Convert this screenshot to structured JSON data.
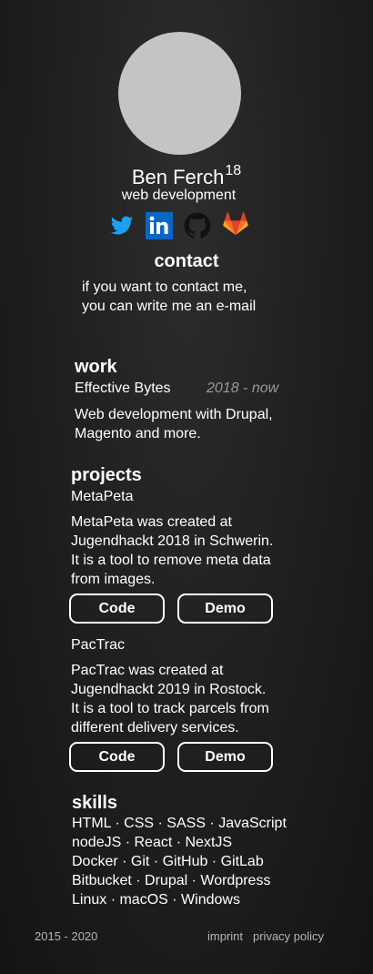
{
  "profile": {
    "name": "Ben Ferch",
    "age": "18",
    "tagline": "web development"
  },
  "socials": [
    {
      "icon": "twitter-icon",
      "color": "#1da1f2"
    },
    {
      "icon": "linkedin-icon",
      "color": "#0a66c2"
    },
    {
      "icon": "github-icon",
      "color": "#111111"
    },
    {
      "icon": "gitlab-icon",
      "color": "#fc6d26"
    }
  ],
  "contact": {
    "title": "contact",
    "line1": "if you want to contact me,",
    "line2": "you can write me an e-mail"
  },
  "work": {
    "title": "work",
    "company": "Effective Bytes",
    "period": "2018 - now",
    "desc_line1": "Web development with Drupal,",
    "desc_line2": "Magento and more."
  },
  "projects": {
    "title": "projects",
    "items": [
      {
        "name": "MetaPeta",
        "lines": [
          "MetaPeta was created at",
          "Jugendhackt 2018 in Schwerin.",
          "It is a tool to remove meta data",
          "from images."
        ],
        "code_label": "Code",
        "demo_label": "Demo"
      },
      {
        "name": "PacTrac",
        "lines": [
          "PacTrac was created at",
          "Jugendhackt 2019 in Rostock.",
          "It is a tool to track parcels from",
          "different delivery services."
        ],
        "code_label": "Code",
        "demo_label": "Demo"
      }
    ]
  },
  "skills": {
    "title": "skills",
    "lines": [
      "HTML · CSS · SASS · JavaScript",
      "nodeJS · React · NextJS",
      "Docker · Git · GitHub · GitLab",
      "Bitbucket · Drupal · Wordpress",
      "Linux · macOS · Windows"
    ]
  },
  "footer": {
    "years": "2015 - 2020",
    "imprint": "imprint",
    "privacy": "privacy policy"
  },
  "colors": {
    "background": "#1e1e1e",
    "avatar": "#c4c4c4",
    "muted_text": "#9a9a9a",
    "footer_text": "#b5b5b5"
  }
}
